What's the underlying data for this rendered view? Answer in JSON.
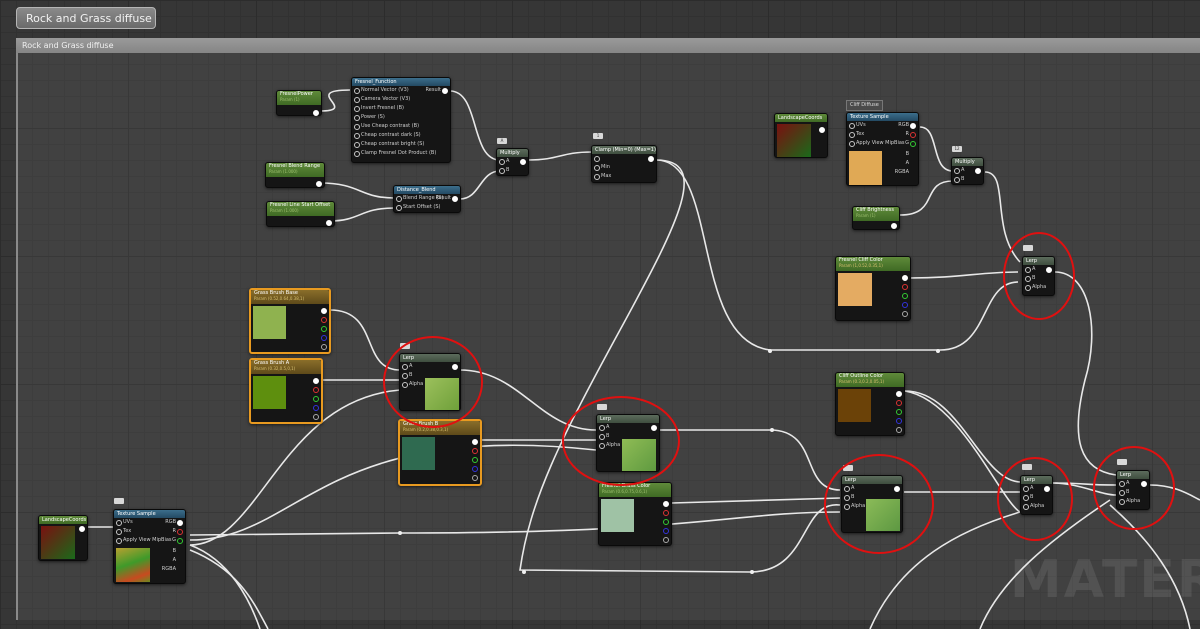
{
  "graph_title": "Rock and Grass diffuse",
  "comment_title": "Rock and Grass diffuse",
  "watermark": "MATERIA",
  "nodes": {
    "fresnel_power": {
      "title": "FresnelPower",
      "sub": "Param (1)"
    },
    "fresnel_blend_range": {
      "title": "Fresnel Blend Range",
      "sub": "Param (1.000)"
    },
    "fresnel_line_start_offset": {
      "title": "Fresnel Line Start Offset",
      "sub": "Param (1.000)"
    },
    "fresnel_function": {
      "title": "Fresnel_Function",
      "inputs": [
        "Normal Vector (V3)",
        "Camera Vector (V3)",
        "Invert Fresnel (B)",
        "Power (S)",
        "Use Cheap contrast (B)",
        "Cheap contrast dark (S)",
        "Cheap contrast bright (S)",
        "Clamp Fresnel Dot Product (B)"
      ],
      "output": "Result"
    },
    "distance_blend": {
      "title": "Distance_Blend",
      "inputs": [
        "Blend Range (S)",
        "Start Offset (S)"
      ],
      "output": "Result"
    },
    "multiply_1": {
      "title": "Multiply",
      "inputs": [
        "A",
        "B"
      ],
      "badge": "A"
    },
    "clamp": {
      "title": "Clamp (Min=0) (Max=1)",
      "inputs": [
        "Min",
        "Max"
      ],
      "badge": "1"
    },
    "landscape_coords_top": {
      "title": "LandscapeCoords"
    },
    "texture_sample_top": {
      "title": "Texture Sample",
      "tag": "Cliff Diffuse",
      "inputs": [
        "UVs",
        "Tex",
        "Apply View MipBias"
      ],
      "outputs": [
        "RGB",
        "R",
        "G",
        "B",
        "A",
        "RGBA"
      ]
    },
    "cliff_brightness": {
      "title": "Cliff Brightness",
      "sub": "Param (1)"
    },
    "multiply_2": {
      "title": "Multiply",
      "inputs": [
        "A",
        "B"
      ],
      "badge": "12"
    },
    "fresnel_cliff_color": {
      "title": "Fresnel Cliff Color",
      "sub": "Param (1,0.52,0.35,1)"
    },
    "lerp_1": {
      "title": "Lerp",
      "inputs": [
        "A",
        "B",
        "Alpha"
      ]
    },
    "grass_brush_base": {
      "title": "Grass Brush Base",
      "sub": "Param (0.52,0.64,0.38,1)"
    },
    "grass_brush_a": {
      "title": "Grass Brush A",
      "sub": "Param (0.32,0.5,0,1)"
    },
    "grass_brush_b": {
      "title": "Grass Brush B",
      "sub": "Param (0.2,0.38,0.3,1)"
    },
    "lerp_grass_1": {
      "title": "Lerp",
      "inputs": [
        "A",
        "B",
        "Alpha"
      ]
    },
    "lerp_grass_2": {
      "title": "Lerp",
      "inputs": [
        "A",
        "B",
        "Alpha"
      ]
    },
    "fresnel_grass_color": {
      "title": "Fresnel Grass Color",
      "sub": "Param (0.6,0.75,0.6,1)"
    },
    "lerp_grass_3": {
      "title": "Lerp",
      "inputs": [
        "A",
        "B",
        "Alpha"
      ]
    },
    "cliff_outline_color": {
      "title": "Cliff Outline Color",
      "sub": "Param (0.3,0.2,0.05,1)"
    },
    "lerp_2": {
      "title": "Lerp",
      "inputs": [
        "A",
        "B",
        "Alpha"
      ]
    },
    "lerp_3": {
      "title": "Lerp",
      "inputs": [
        "A",
        "B",
        "Alpha"
      ]
    },
    "landscape_coords_bottom": {
      "title": "LandscapeCoords"
    },
    "texture_sample_bottom": {
      "title": "Texture Sample",
      "inputs": [
        "UVs",
        "Tex",
        "Apply View MipBias"
      ],
      "outputs": [
        "RGB",
        "R",
        "G",
        "B",
        "A",
        "RGBA"
      ]
    }
  },
  "colors": {
    "grass_brush_base": "#8fb24f",
    "grass_brush_a": "#5e8f0e",
    "grass_brush_b": "#2f6a50",
    "fresnel_grass_color": "#9fc2a5",
    "fresnel_cliff_color": "#e4ab62",
    "cliff_outline_color": "#6b4208",
    "cliff_diffuse": "#e0a955",
    "highlight": "#e01010"
  }
}
